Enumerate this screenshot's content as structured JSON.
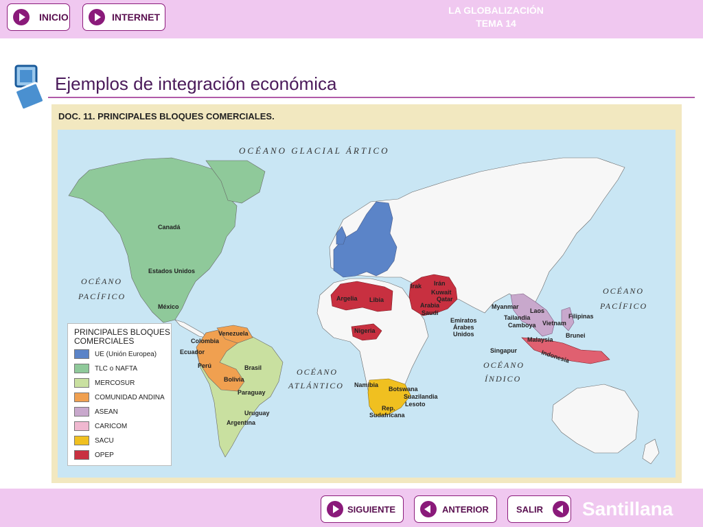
{
  "header": {
    "inicio_label": "INICIO",
    "internet_label": "INTERNET",
    "title_line1": "LA GLOBALIZACIÓN",
    "title_line2": "TEMA 14"
  },
  "main": {
    "page_title": "Ejemplos de integración económica",
    "doc_caption": "DOC. 11. PRINCIPALES BLOQUES COMERCIALES."
  },
  "map": {
    "labels": {
      "oceano_glacial": "OCÉANO GLACIAL ÁRTICO",
      "oceano_pacifico_w1": "OCÉANO",
      "oceano_pacifico_w2": "PACÍFICO",
      "oceano_pacifico_e1": "OCÉANO",
      "oceano_pacifico_e2": "PACÍFICO",
      "oceano_atlantico1": "OCÉANO",
      "oceano_atlantico2": "ATLÁNTICO",
      "oceano_indico1": "OCÉANO",
      "oceano_indico2": "ÍNDICO",
      "canada": "Canadá",
      "eeuu": "Estados Unidos",
      "mexico": "México",
      "venezuela": "Venezuela",
      "colombia": "Colombia",
      "ecuador": "Ecuador",
      "peru": "Perú",
      "bolivia": "Bolivia",
      "brasil": "Brasil",
      "paraguay": "Paraguay",
      "uruguay": "Uruguay",
      "argentina": "Argentina",
      "argelia": "Argelia",
      "libia": "Libia",
      "nigeria": "Nigeria",
      "irak": "Irak",
      "iran": "Irán",
      "kuwait": "Kuwait",
      "qatar": "Qatar",
      "arabia1": "Arabia",
      "arabia2": "Saudí",
      "emiratos1": "Emiratos",
      "emiratos2": "Árabes",
      "emiratos3": "Unidos",
      "namibia": "Namibia",
      "botswana": "Botswana",
      "suazilandia": "Suazilandia",
      "lesoto": "Lesoto",
      "rep": "Rep.",
      "sudafricana": "Sudafricana",
      "myanmar": "Myanmar",
      "laos": "Laos",
      "tailandia": "Tailandia",
      "camboya": "Camboya",
      "vietnam": "Vietnam",
      "filipinas": "Filipinas",
      "malaysia": "Malaysia",
      "brunei": "Brunei",
      "singapur": "Singapur",
      "indonesia": "Indonesia"
    }
  },
  "legend": {
    "title": "PRINCIPALES BLOQUES COMERCIALES",
    "items": [
      {
        "label": "UE (Unión Europea)",
        "color": "#5b84c8"
      },
      {
        "label": "TLC o NAFTA",
        "color": "#8fc99a"
      },
      {
        "label": "MERCOSUR",
        "color": "#c9e0a0"
      },
      {
        "label": "COMUNIDAD ANDINA",
        "color": "#f0a050"
      },
      {
        "label": "ASEAN",
        "color": "#c8a8cc"
      },
      {
        "label": "CARICOM",
        "color": "#f0b8d0"
      },
      {
        "label": "SACU",
        "color": "#f0c020"
      },
      {
        "label": "OPEP",
        "color": "#c83040"
      }
    ]
  },
  "footer": {
    "siguiente_label": "SIGUIENTE",
    "anterior_label": "ANTERIOR",
    "salir_label": "SALIR",
    "brand": "Santillana"
  }
}
